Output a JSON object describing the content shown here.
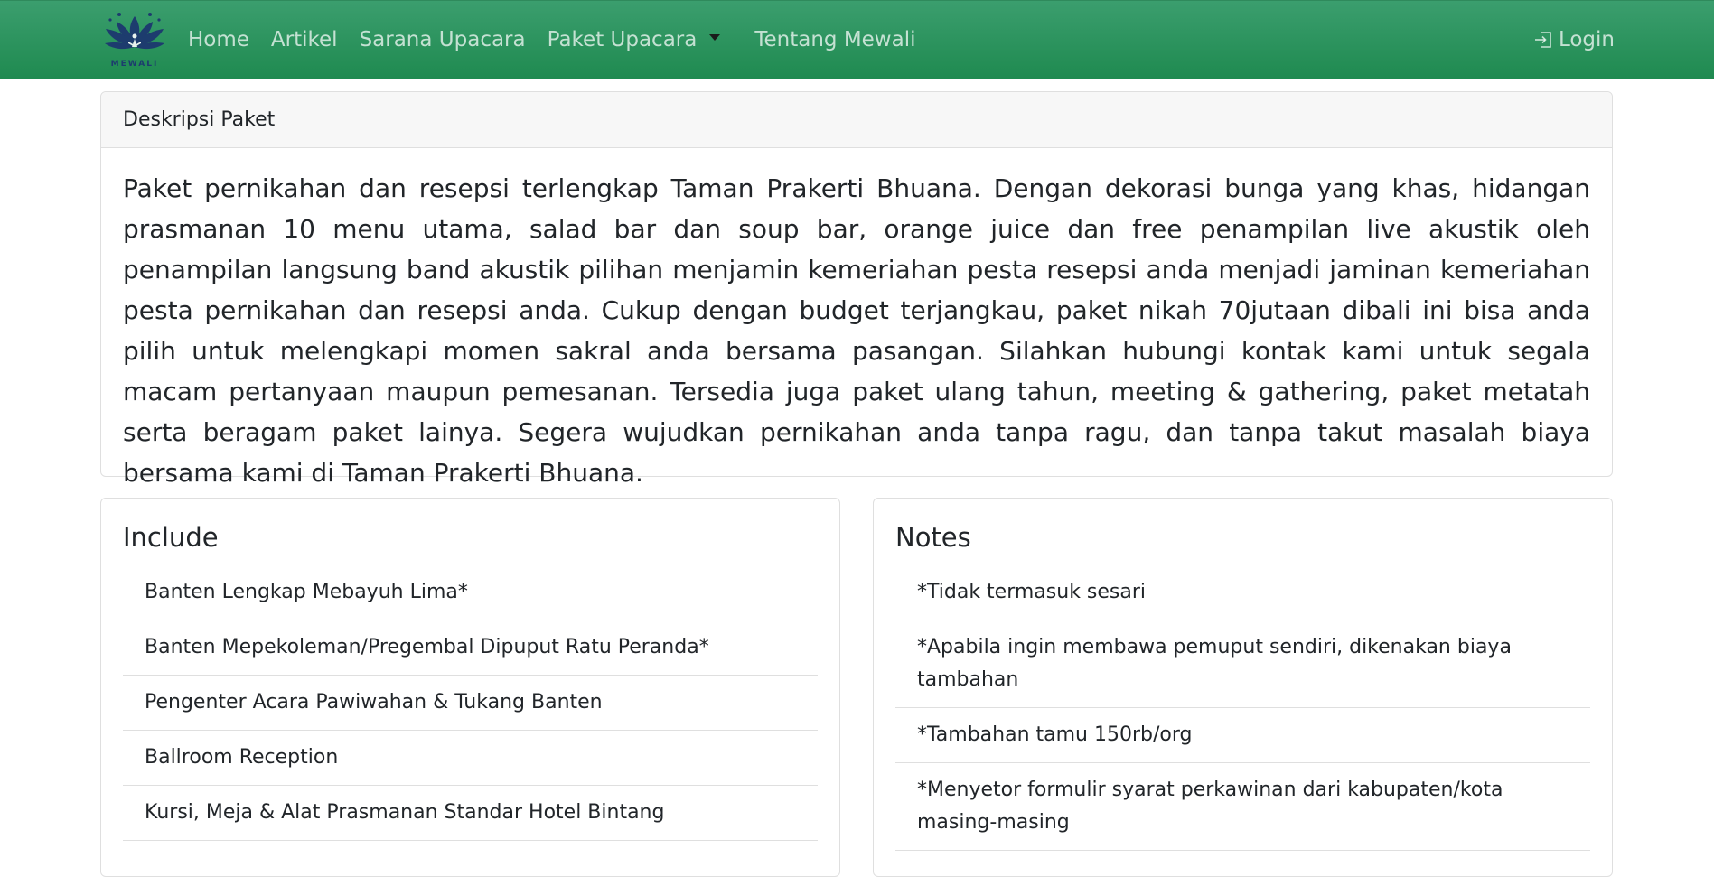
{
  "nav": {
    "brand_text": "MEWALI",
    "links": [
      "Home",
      "Artikel",
      "Sarana Upacara",
      "Paket Upacara",
      "Tentang Mewali"
    ],
    "login": "Login"
  },
  "description": {
    "header": "Deskripsi Paket",
    "body": "Paket pernikahan dan resepsi terlengkap Taman Prakerti Bhuana. Dengan dekorasi bunga yang khas, hidangan prasmanan 10 menu utama, salad bar dan soup bar, orange juice dan free penampilan live akustik oleh penampilan langsung band akustik pilihan menjamin kemeriahan pesta resepsi anda menjadi jaminan kemeriahan pesta pernikahan dan resepsi anda. Cukup dengan budget terjangkau, paket nikah 70jutaan dibali ini bisa anda pilih untuk melengkapi momen sakral anda bersama pasangan. Silahkan hubungi kontak kami untuk segala macam pertanyaan maupun pemesanan. Tersedia juga paket ulang tahun, meeting & gathering, paket metatah serta beragam paket lainya. Segera wujudkan pernikahan anda tanpa ragu, dan tanpa takut masalah biaya bersama kami di Taman Prakerti Bhuana."
  },
  "include": {
    "title": "Include",
    "items": [
      "Banten Lengkap Mebayuh Lima*",
      "Banten Mepekoleman/Pregembal Dipuput Ratu Peranda*",
      "Pengenter Acara Pawiwahan & Tukang Banten",
      "Ballroom Reception",
      "Kursi, Meja & Alat Prasmanan Standar Hotel Bintang"
    ]
  },
  "notes": {
    "title": "Notes",
    "items": [
      "*Tidak termasuk sesari",
      "*Apabila ingin membawa pemuput sendiri, dikenakan biaya tambahan",
      "*Tambahan tamu 150rb/org",
      "*Menyetor formulir syarat perkawinan dari kabupaten/kota masing-masing"
    ]
  },
  "colors": {
    "navbar": "#26915a",
    "logo": "#1d3c6e"
  }
}
